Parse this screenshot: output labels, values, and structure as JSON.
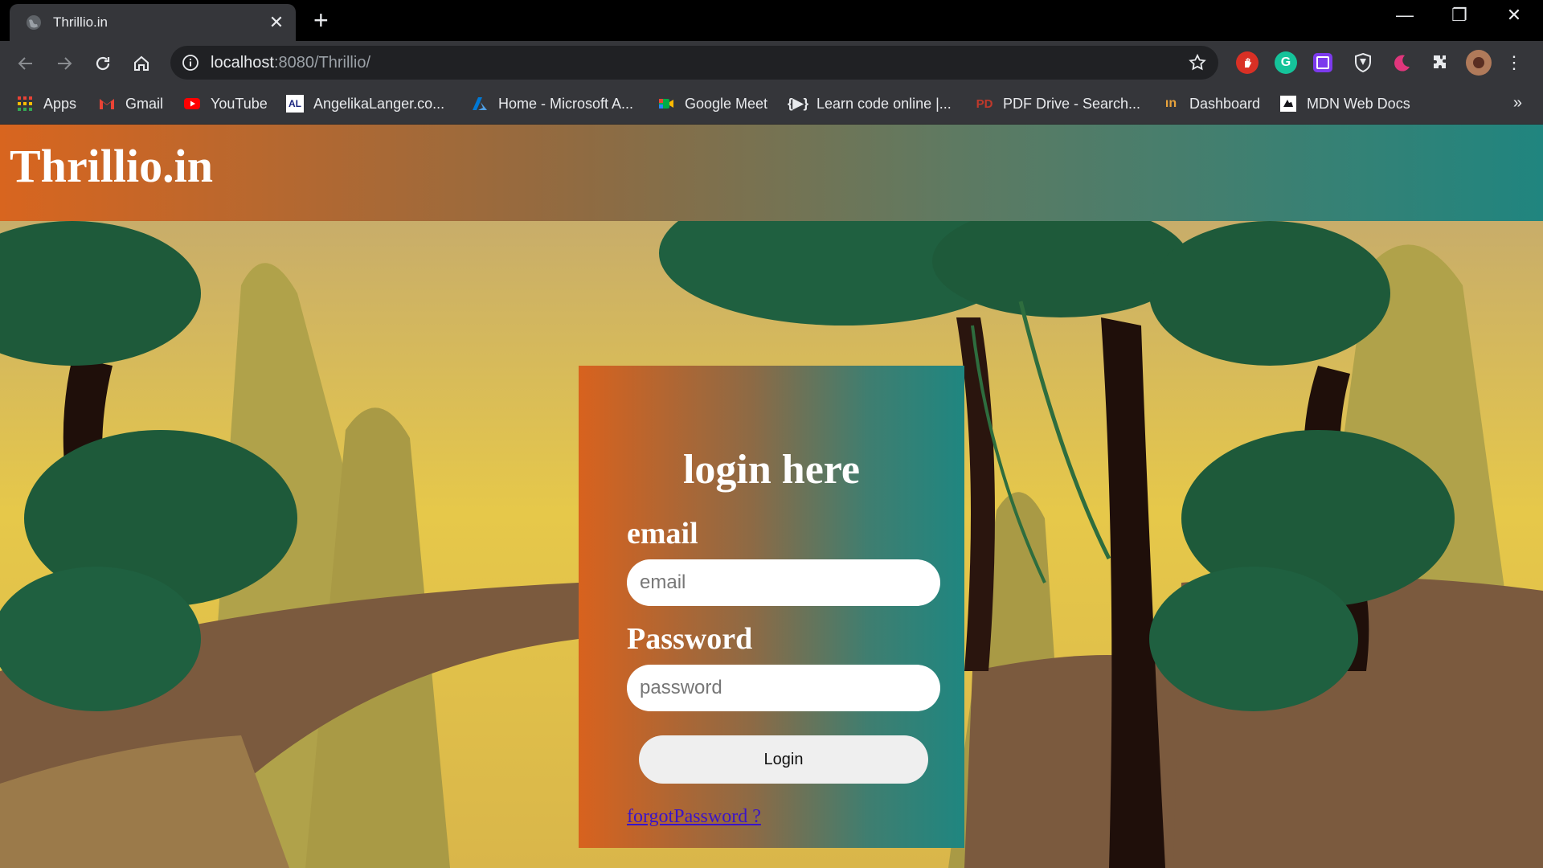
{
  "browser": {
    "tab": {
      "title": "Thrillio.in"
    },
    "address": {
      "host": "localhost",
      "rest": ":8080/Thrillio/"
    },
    "bookmarks": [
      {
        "label": "Apps",
        "icon": "apps-grid-icon",
        "color": "#e94235"
      },
      {
        "label": "Gmail",
        "icon": "gmail-icon",
        "color": "#ea4335"
      },
      {
        "label": "YouTube",
        "icon": "youtube-icon",
        "color": "#ff0000"
      },
      {
        "label": "AngelikaLanger.co...",
        "icon": "angelikalanger-icon",
        "color": "#ffffff"
      },
      {
        "label": "Home - Microsoft A...",
        "icon": "azure-icon",
        "color": "#0078d4"
      },
      {
        "label": "Google Meet",
        "icon": "google-meet-icon",
        "color": "#00ac47"
      },
      {
        "label": "Learn code online |...",
        "icon": "codecademy-icon",
        "color": "#e8eaed"
      },
      {
        "label": "PDF Drive - Search...",
        "icon": "pdfdrive-icon",
        "color": "#c0392b"
      },
      {
        "label": "Dashboard",
        "icon": "dashboard-icon",
        "color": "#e8a33c"
      },
      {
        "label": "MDN Web Docs",
        "icon": "mdn-icon",
        "color": "#ffffff"
      }
    ]
  },
  "site": {
    "title": "Thrillio.in",
    "login": {
      "heading": "login here",
      "email_label": "email",
      "email_placeholder": "email",
      "password_label": "Password",
      "password_placeholder": "password",
      "login_button": "Login",
      "forgot_link": "forgotPassword ?"
    }
  }
}
